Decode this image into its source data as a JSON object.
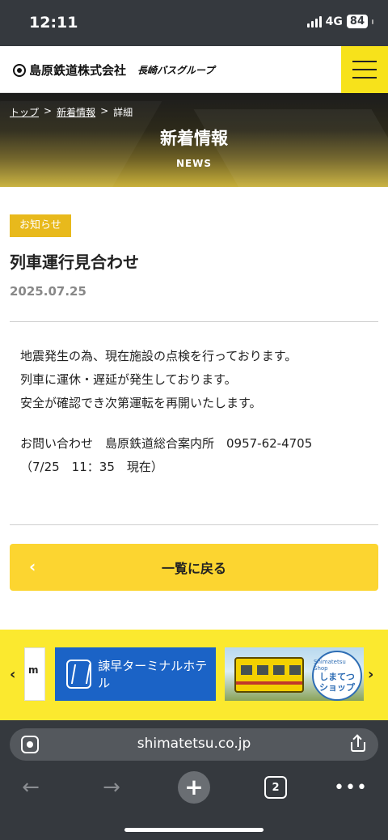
{
  "status_bar": {
    "time": "12:11",
    "network": "4G",
    "battery": "84"
  },
  "header": {
    "logo_text": "島原鉄道株式会社",
    "logo_sub": "長崎バスグループ"
  },
  "breadcrumb": {
    "home": "トップ",
    "separator": ">",
    "news": "新着情報",
    "current": "詳細"
  },
  "hero": {
    "title": "新着情報",
    "subtitle": "NEWS"
  },
  "article": {
    "category": "お知らせ",
    "title": "列車運行見合わせ",
    "date": "2025.07.25",
    "body": [
      "地震発生の為、現在施設の点検を行っております。",
      "列車に運休・遅延が発生しております。",
      "安全が確認でき次第運転を再開いたします。"
    ],
    "contact": "お問い合わせ　島原鉄道総合案内所　0957-62-4705",
    "note": "（7/25　11：35　現在）"
  },
  "back_button": {
    "chevron": "‹",
    "label": "一覧に戻る"
  },
  "banners": {
    "prev_arrow": "‹",
    "next_arrow": "›",
    "partial_text": "m",
    "hotel_name": "諫早ターミナルホテル",
    "shop_ring_text": "Shimatetsu Shop",
    "shop_name": "しまてつ\nショップ"
  },
  "browser": {
    "url": "shimatetsu.co.jp",
    "tab_count": "2",
    "back_icon": "←",
    "forward_icon": "→",
    "add_icon": "+",
    "more_icon": "•••"
  },
  "colors": {
    "accent_yellow": "#f7e21b",
    "badge": "#e8b91c",
    "hotel_blue": "#1b63c6",
    "browser_chrome": "#35393e"
  }
}
